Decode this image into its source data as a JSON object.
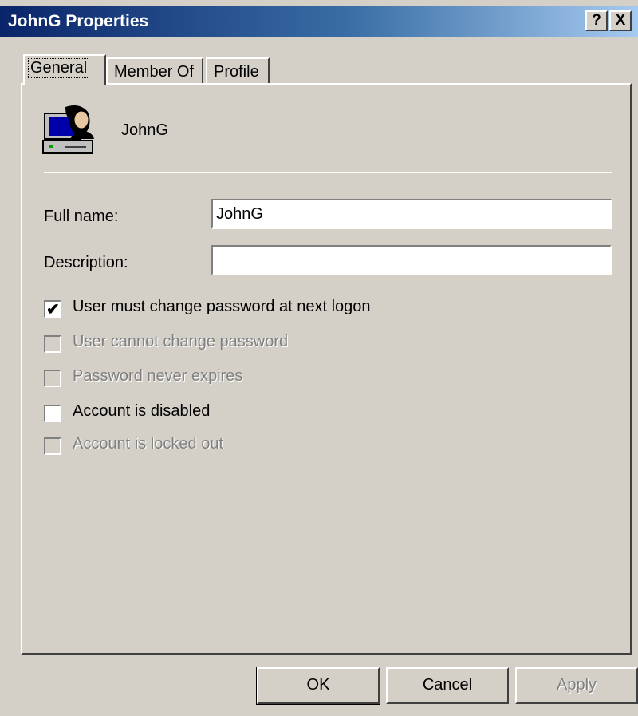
{
  "window": {
    "title": "JohnG Properties",
    "help_label": "?",
    "close_label": "X"
  },
  "tabs": [
    {
      "label": "General",
      "active": true
    },
    {
      "label": "Member Of",
      "active": false
    },
    {
      "label": "Profile",
      "active": false
    }
  ],
  "general": {
    "user_name": "JohnG",
    "full_name": {
      "label": "Full name:",
      "value": "JohnG"
    },
    "description": {
      "label": "Description:",
      "value": ""
    },
    "checkboxes": [
      {
        "label": "User must change password at next logon",
        "checked": true,
        "enabled": true
      },
      {
        "label": "User cannot change password",
        "checked": false,
        "enabled": false
      },
      {
        "label": "Password never expires",
        "checked": false,
        "enabled": false
      },
      {
        "label": "Account is disabled",
        "checked": false,
        "enabled": true
      },
      {
        "label": "Account is locked out",
        "checked": false,
        "enabled": false
      }
    ]
  },
  "buttons": {
    "ok": "OK",
    "cancel": "Cancel",
    "apply": "Apply"
  },
  "icons": {
    "user": "user-computer-icon",
    "help": "help-icon",
    "close": "close-icon"
  },
  "colors": {
    "titlebar_start": "#0a246a",
    "titlebar_end": "#a6caf0",
    "dialog_bg": "#d4d0c8"
  }
}
